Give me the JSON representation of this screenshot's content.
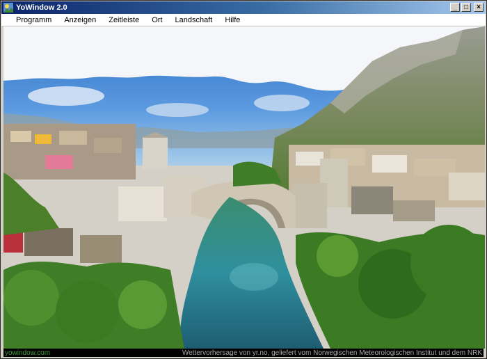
{
  "window": {
    "title": "YoWindow 2.0",
    "controls": {
      "minimize": "_",
      "maximize": "□",
      "close": "×"
    }
  },
  "menu": {
    "items": [
      "Programm",
      "Anzeigen",
      "Zeitleiste",
      "Ort",
      "Landschaft",
      "Hilfe"
    ]
  },
  "scene": {
    "sky_top_color": "#2b6fc4",
    "sky_bottom_color": "#9fc7e8",
    "river_color": "#2f8f9e",
    "icons": [
      "mountain",
      "bridge",
      "tower",
      "town",
      "river",
      "trees",
      "clouds"
    ]
  },
  "statusbar": {
    "brand": "yowindow.com",
    "credit": "Wettervorhersage von yr.no, geliefert vom Norwegischen Meteorologischen Institut und dem NRK"
  }
}
